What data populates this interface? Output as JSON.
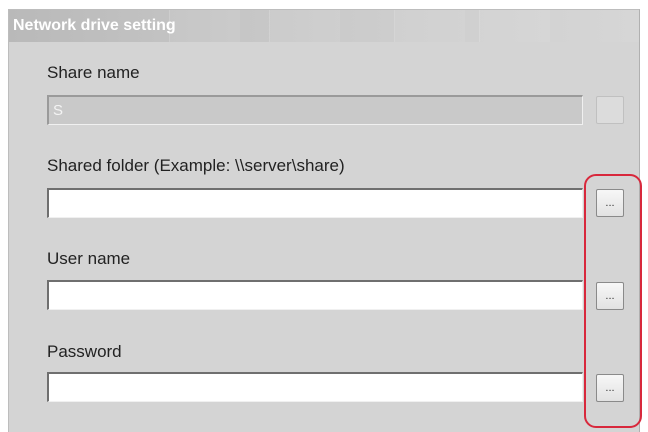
{
  "dialog": {
    "title": "Network drive setting"
  },
  "fields": {
    "share_name": {
      "label": "Share name",
      "value": "S",
      "button_label": "..."
    },
    "shared_folder": {
      "label": "Shared folder (Example:  \\\\server\\share)",
      "value": "",
      "button_label": "..."
    },
    "user_name": {
      "label": "User name",
      "value": "",
      "button_label": "..."
    },
    "password": {
      "label": "Password",
      "value": "",
      "button_label": "..."
    }
  },
  "colors": {
    "highlight": "#d8283c",
    "panel": "#d4d4d4"
  }
}
